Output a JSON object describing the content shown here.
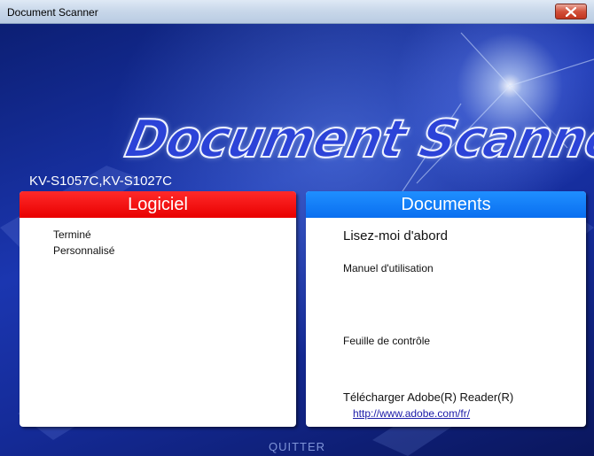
{
  "window": {
    "title": "Document Scanner"
  },
  "banner": {
    "logo": "Document Scanner",
    "model": "KV-S1057C,KV-S1027C"
  },
  "colors": {
    "software_header": "#f00000",
    "documents_header": "#1a82fa",
    "banner_bg": "#1b36b0",
    "link": "#1a1aa8"
  },
  "software_panel": {
    "title": "Logiciel",
    "items": [
      "Terminé",
      "Personnalisé"
    ]
  },
  "documents_panel": {
    "title": "Documents",
    "readme": "Lisez-moi d'abord",
    "manual": "Manuel d'utilisation",
    "checksheet": "Feuille de contrôle",
    "download": "Télécharger Adobe(R) Reader(R)",
    "download_link": "http://www.adobe.com/fr/"
  },
  "quit_label": "QUITTER",
  "icons": {
    "close": "close-icon"
  }
}
